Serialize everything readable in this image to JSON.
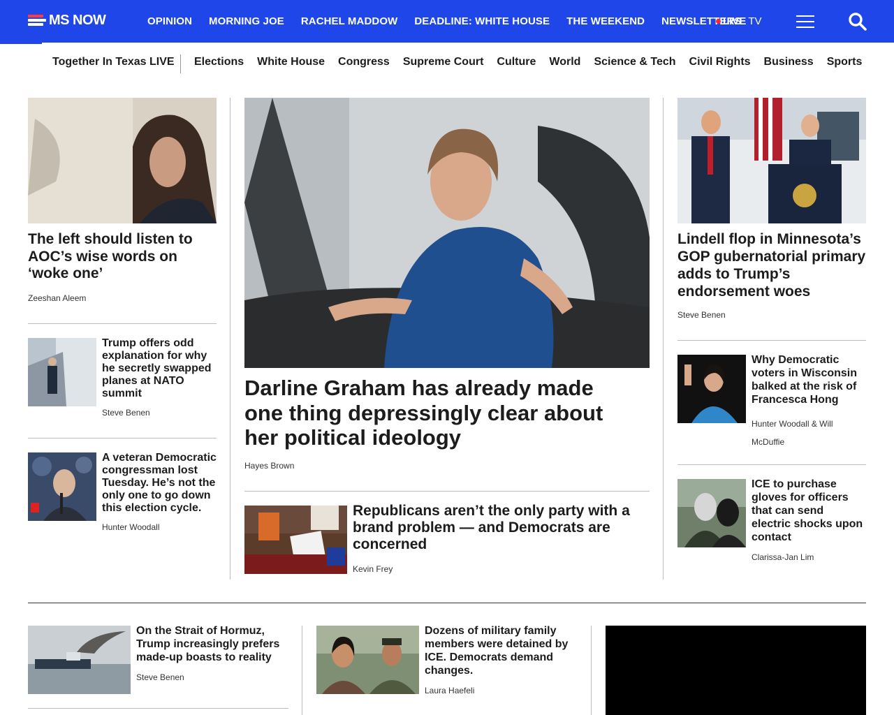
{
  "brand": {
    "name": "MS NOW"
  },
  "nav": {
    "items": [
      "OPINION",
      "MORNING JOE",
      "RACHEL MADDOW",
      "DEADLINE: WHITE HOUSE",
      "THE WEEKEND",
      "NEWSLETTERS"
    ],
    "live_label": "LIVE",
    "live_suffix": "TV",
    "menu_icon": "hamburger-menu-icon",
    "search_icon": "search-icon"
  },
  "subnav": {
    "featured": "Together In Texas LIVE",
    "items": [
      "Elections",
      "White House",
      "Congress",
      "Supreme Court",
      "Culture",
      "World",
      "Science & Tech",
      "Civil Rights",
      "Business",
      "Sports"
    ]
  },
  "left_column": {
    "main": {
      "headline": "The left should listen to AOC’s wise words on ‘woke one’",
      "byline": "Zeeshan Aleem"
    },
    "stories": [
      {
        "headline": "Trump offers odd explanation for why he secretly swapped planes at NATO summit",
        "byline": "Steve Benen"
      },
      {
        "headline": "A veteran Democratic congressman lost Tuesday. He’s not the only one to go down this election cycle.",
        "byline": "Hunter Woodall"
      }
    ]
  },
  "center_column": {
    "main": {
      "headline": "Darline Graham has already made one thing depressingly clear about her political ideology",
      "byline": "Hayes Brown"
    },
    "sub": {
      "headline": "Republicans aren’t the only party with a brand problem — and Democrats are concerned",
      "byline": "Kevin Frey"
    }
  },
  "right_column": {
    "main": {
      "headline": "Lindell flop in Minnesota’s GOP gubernatorial primary adds to Trump’s endorsement woes",
      "byline": "Steve Benen"
    },
    "stories": [
      {
        "headline": "Why Democratic voters in Wisconsin balked at the risk of Francesca Hong",
        "byline": "Hunter Woodall & Will McDuffie"
      },
      {
        "headline": "ICE to purchase gloves for officers that can send electric shocks upon contact",
        "byline": "Clarissa-Jan Lim"
      }
    ]
  },
  "bottom_row": [
    {
      "headline": "On the Strait of Hormuz, Trump increasingly prefers made-up boasts to reality",
      "byline": "Steve Benen"
    },
    {
      "headline": "Dozens of military family members were detained by ICE. Democrats demand changes.",
      "byline": "Laura Haefeli"
    }
  ]
}
